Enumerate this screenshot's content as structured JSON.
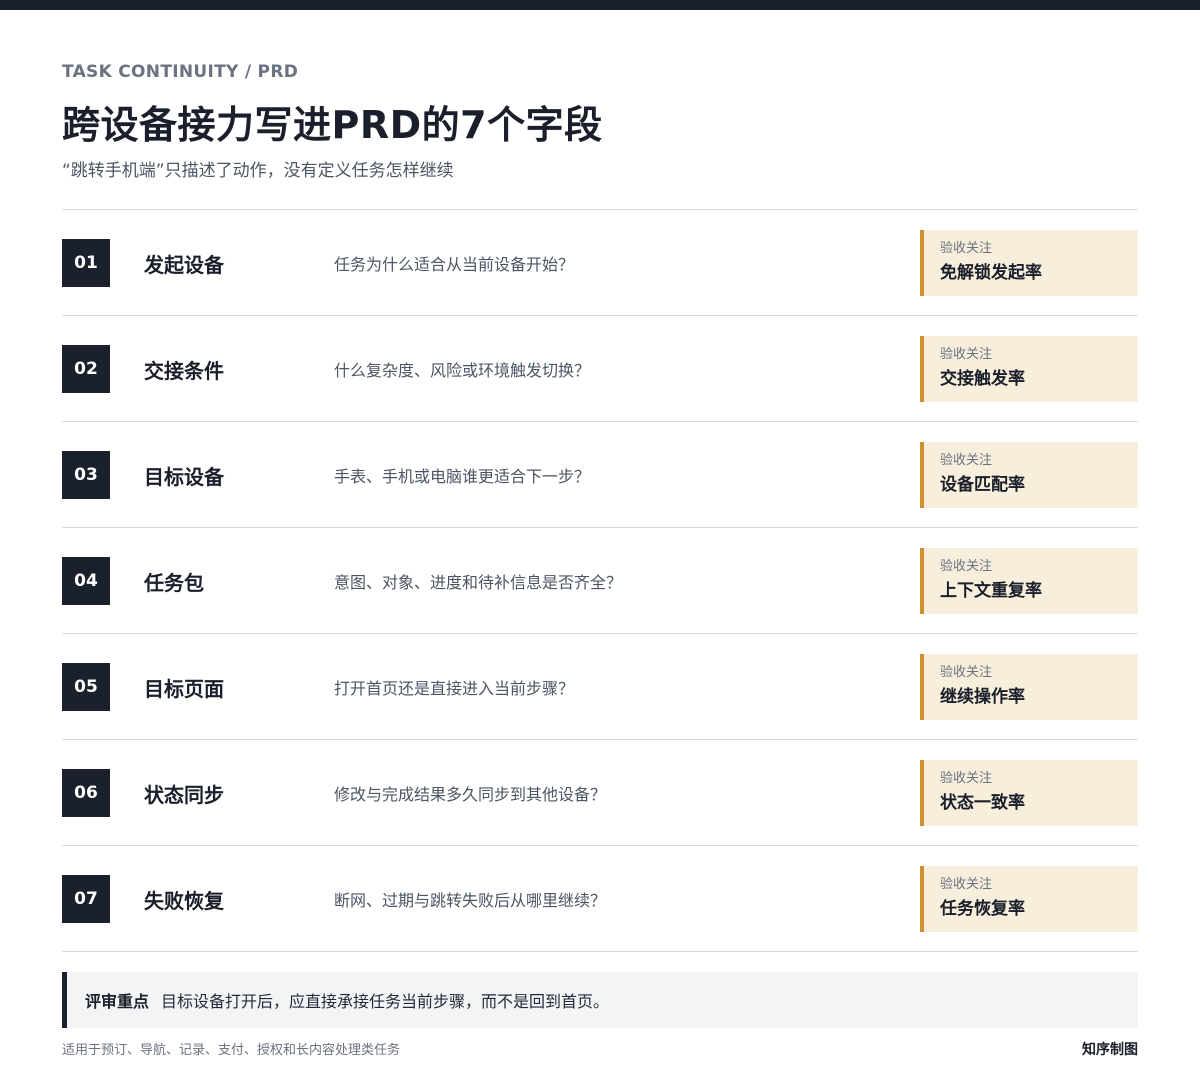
{
  "header": {
    "kicker": "TASK CONTINUITY / PRD",
    "title": "跨设备接力写进PRD的7个字段",
    "subtitle": "“跳转手机端”只描述了动作，没有定义任务怎样继续"
  },
  "rows": [
    {
      "num": "01",
      "field": "发起设备",
      "question": "任务为什么适合从当前设备开始？",
      "metric_label": "验收关注",
      "metric_value": "免解锁发起率"
    },
    {
      "num": "02",
      "field": "交接条件",
      "question": "什么复杂度、风险或环境触发切换？",
      "metric_label": "验收关注",
      "metric_value": "交接触发率"
    },
    {
      "num": "03",
      "field": "目标设备",
      "question": "手表、手机或电脑谁更适合下一步？",
      "metric_label": "验收关注",
      "metric_value": "设备匹配率"
    },
    {
      "num": "04",
      "field": "任务包",
      "question": "意图、对象、进度和待补信息是否齐全？",
      "metric_label": "验收关注",
      "metric_value": "上下文重复率"
    },
    {
      "num": "05",
      "field": "目标页面",
      "question": "打开首页还是直接进入当前步骤？",
      "metric_label": "验收关注",
      "metric_value": "继续操作率"
    },
    {
      "num": "06",
      "field": "状态同步",
      "question": "修改与完成结果多久同步到其他设备？",
      "metric_label": "验收关注",
      "metric_value": "状态一致率"
    },
    {
      "num": "07",
      "field": "失败恢复",
      "question": "断网、过期与跳转失败后从哪里继续？",
      "metric_label": "验收关注",
      "metric_value": "任务恢复率"
    }
  ],
  "note": {
    "label": "评审重点",
    "text": "目标设备打开后，应直接承接任务当前步骤，而不是回到首页。"
  },
  "footer": {
    "left": "适用于预订、导航、记录、支付、授权和长内容处理类任务",
    "right": "知序制图"
  },
  "colors": {
    "dark": "#1b212c",
    "accent": "#d0902e",
    "metric_bg": "#f7eedb"
  }
}
